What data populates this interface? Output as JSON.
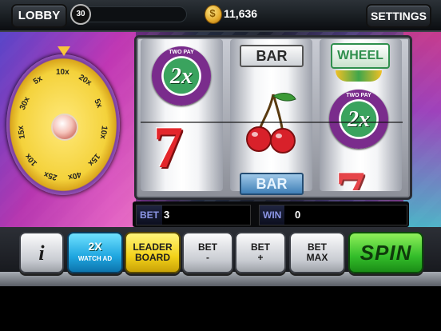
{
  "topbar": {
    "lobby_label": "LOBBY",
    "level": "30",
    "coins": "11,636",
    "coin_symbol": "$",
    "settings_label": "SETTINGS"
  },
  "wheel": {
    "segments": [
      "10x",
      "20x",
      "5x",
      "10x",
      "15x",
      "40x",
      "25x",
      "10x",
      "15x",
      "30x",
      "5x"
    ],
    "colors": [
      "#f7d83a",
      "#ffffff"
    ]
  },
  "reels": {
    "reel1": {
      "top_symbol": "2x",
      "top_caption": "TWO PAY",
      "middle_symbol": "7"
    },
    "reel2": {
      "top_symbol": "BAR",
      "middle_symbol": "cherry-icon",
      "bottom_symbol": "BAR"
    },
    "reel3": {
      "top_symbol": "WHEEL",
      "middle_symbol": "2x",
      "middle_caption": "TWO PAY",
      "bottom_symbol": "7"
    }
  },
  "info": {
    "bet_label": "BET",
    "bet_value": "3",
    "win_label": "WIN",
    "win_value": "0"
  },
  "buttons": {
    "info": "i",
    "watch_2x": "2X",
    "watch_ad": "WATCH AD",
    "leader_line1": "LEADER",
    "leader_line2": "BOARD",
    "bet_minus_line1": "BET",
    "bet_minus_line2": "-",
    "bet_plus_line1": "BET",
    "bet_plus_line2": "+",
    "bet_max_line1": "BET",
    "bet_max_line2": "MAX",
    "spin": "SPIN"
  },
  "colors": {
    "spin_green": "#33bd2a",
    "leader_yellow": "#f3d21a",
    "watch_blue": "#1fa6e0",
    "seven_red": "#e3262b"
  }
}
